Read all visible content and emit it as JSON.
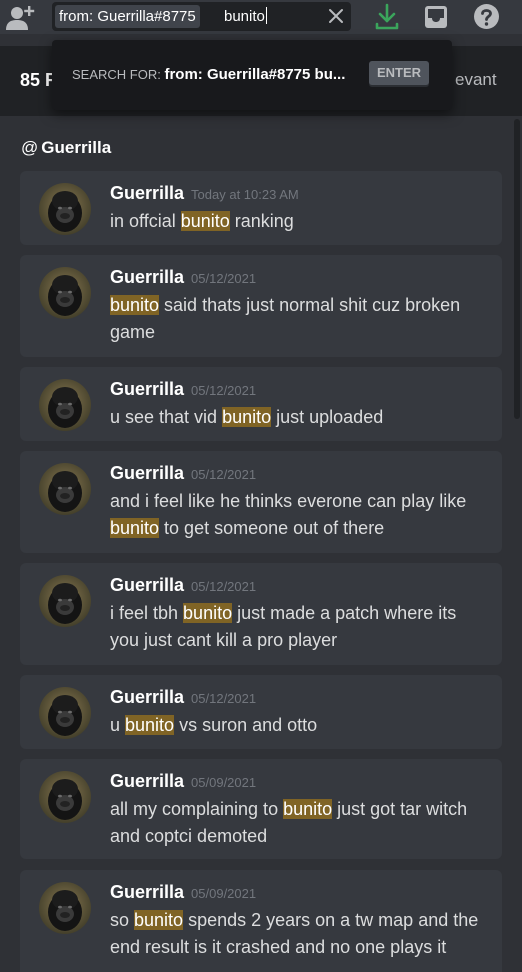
{
  "topbar": {
    "search": {
      "filter_token": "from: Guerrilla#8775",
      "query": "bunito"
    },
    "icons": [
      "add-friend-icon",
      "download-icon",
      "inbox-icon",
      "help-icon"
    ]
  },
  "popout": {
    "prefix": "SEARCH FOR:",
    "term": "from: Guerrilla#8775 bu...",
    "enter_label": "ENTER"
  },
  "results": {
    "count_label": "85 R",
    "sort_label": "evant"
  },
  "channel": {
    "at": "@",
    "name": "Guerrilla"
  },
  "highlight_term": "bunito",
  "messages": [
    {
      "author": "Guerrilla",
      "timestamp": "Today at 10:23 AM",
      "text_before": "in offcial ",
      "highlight": "bunito",
      "text_after": " ranking"
    },
    {
      "author": "Guerrilla",
      "timestamp": "05/12/2021",
      "text_before": "",
      "highlight": "bunito",
      "text_after": " said thats just normal shit cuz broken game"
    },
    {
      "author": "Guerrilla",
      "timestamp": "05/12/2021",
      "text_before": "u see that vid ",
      "highlight": "bunito",
      "text_after": " just uploaded"
    },
    {
      "author": "Guerrilla",
      "timestamp": "05/12/2021",
      "text_before": "and i feel like he thinks everone can play like ",
      "highlight": "bunito",
      "text_after": " to get someone out of there"
    },
    {
      "author": "Guerrilla",
      "timestamp": "05/12/2021",
      "text_before": "i feel tbh ",
      "highlight": "bunito",
      "text_after": " just made a patch where its you just cant kill a pro player"
    },
    {
      "author": "Guerrilla",
      "timestamp": "05/12/2021",
      "text_before": "u ",
      "highlight": "bunito",
      "text_after": " vs suron and otto"
    },
    {
      "author": "Guerrilla",
      "timestamp": "05/09/2021",
      "text_before": "all my complaining to ",
      "highlight": "bunito",
      "text_after": " just got tar witch and coptci demoted"
    },
    {
      "author": "Guerrilla",
      "timestamp": "05/09/2021",
      "text_before": "so ",
      "highlight": "bunito",
      "text_after": " spends 2 years on a tw map and the end result is it crashed and no one plays it"
    }
  ],
  "colors": {
    "background": "#2f3136",
    "card": "#36393f",
    "highlight": "#806425",
    "download_green": "#3ba55c"
  }
}
